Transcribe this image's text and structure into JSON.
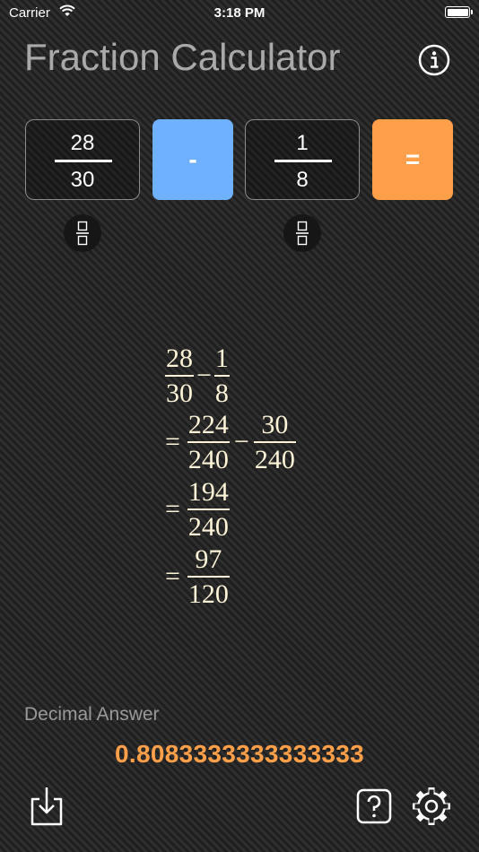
{
  "status_bar": {
    "carrier": "Carrier",
    "time": "3:18 PM"
  },
  "app": {
    "title": "Fraction Calculator"
  },
  "input": {
    "fraction_a": {
      "numerator": "28",
      "denominator": "30"
    },
    "operator": "-",
    "fraction_b": {
      "numerator": "1",
      "denominator": "8"
    },
    "equals": "="
  },
  "steps": {
    "row1": {
      "a_num": "28",
      "a_den": "30",
      "op": "−",
      "b_num": "1",
      "b_den": "8"
    },
    "row2": {
      "eq": "=",
      "a_num": "224",
      "a_den": "240",
      "op": "−",
      "b_num": "30",
      "b_den": "240"
    },
    "row3": {
      "eq": "=",
      "num": "194",
      "den": "240"
    },
    "row4": {
      "eq": "=",
      "num": "97",
      "den": "120"
    }
  },
  "decimal": {
    "label": "Decimal Answer",
    "value": "0.8083333333333333"
  },
  "icons": {
    "info": "info-icon",
    "fraction_toggle": "fraction-icon",
    "save": "save-icon",
    "help": "help-icon",
    "settings": "gear-icon"
  },
  "colors": {
    "operator": "#6fb1ff",
    "equals": "#ff9f4a",
    "decimal_value": "#ff9f4a",
    "math_text": "#fdf4d8"
  }
}
